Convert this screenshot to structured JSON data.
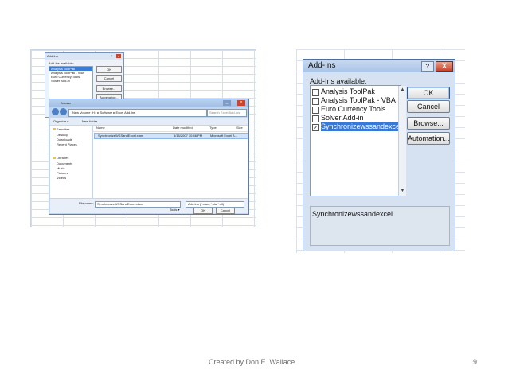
{
  "left_screenshot": {
    "small_dialog": {
      "title": "Add-Ins",
      "available_label": "Add-Ins available:",
      "items": [
        "Analysis ToolPak",
        "Analysis ToolPak - VBA",
        "Euro Currency Tools",
        "Solver Add-in"
      ],
      "buttons": [
        "OK",
        "Cancel",
        "Browse...",
        "Automation..."
      ]
    },
    "browse_dialog": {
      "title": "Browse",
      "address": "New Volume (H:)  ▸  Software  ▸  Excel Add-Ins",
      "search_placeholder": "Search Excel Add-Ins",
      "toolbar": {
        "organize": "Organize ▾",
        "new_folder": "New folder"
      },
      "favorites": [
        "Favorites",
        "Desktop",
        "Downloads",
        "Recent Places"
      ],
      "libraries": [
        "Libraries",
        "Documents",
        "Music",
        "Pictures",
        "Videos"
      ],
      "columns": [
        "Name",
        "Date modified",
        "Type",
        "Size"
      ],
      "file": {
        "name": "SynchronizeWSSandExcel.xlam",
        "date": "5/15/2007 10:46 PM",
        "type": "Microsoft Excel A..."
      },
      "filename_label": "File name:",
      "filename_value": "SynchronizeWSSandExcel.xlam",
      "filetype_value": "Add-Ins (*.xlam;*.xla;*.xll)",
      "tools": "Tools ▾",
      "ok": "OK",
      "cancel": "Cancel"
    }
  },
  "addins_dialog": {
    "title": "Add-Ins",
    "help": "?",
    "close": "X",
    "available_label": "Add-Ins available:",
    "items": [
      {
        "label": "Analysis ToolPak",
        "checked": false
      },
      {
        "label": "Analysis ToolPak - VBA",
        "checked": false
      },
      {
        "label": "Euro Currency Tools",
        "checked": false
      },
      {
        "label": "Solver Add-in",
        "checked": false
      },
      {
        "label": "Synchronizewssandexcel",
        "checked": true
      }
    ],
    "buttons": {
      "ok": "OK",
      "cancel": "Cancel",
      "browse": "Browse...",
      "automation": "Automation..."
    },
    "description": "Synchronizewssandexcel"
  },
  "footer": {
    "credit": "Created by Don E. Wallace",
    "page_number": "9"
  }
}
